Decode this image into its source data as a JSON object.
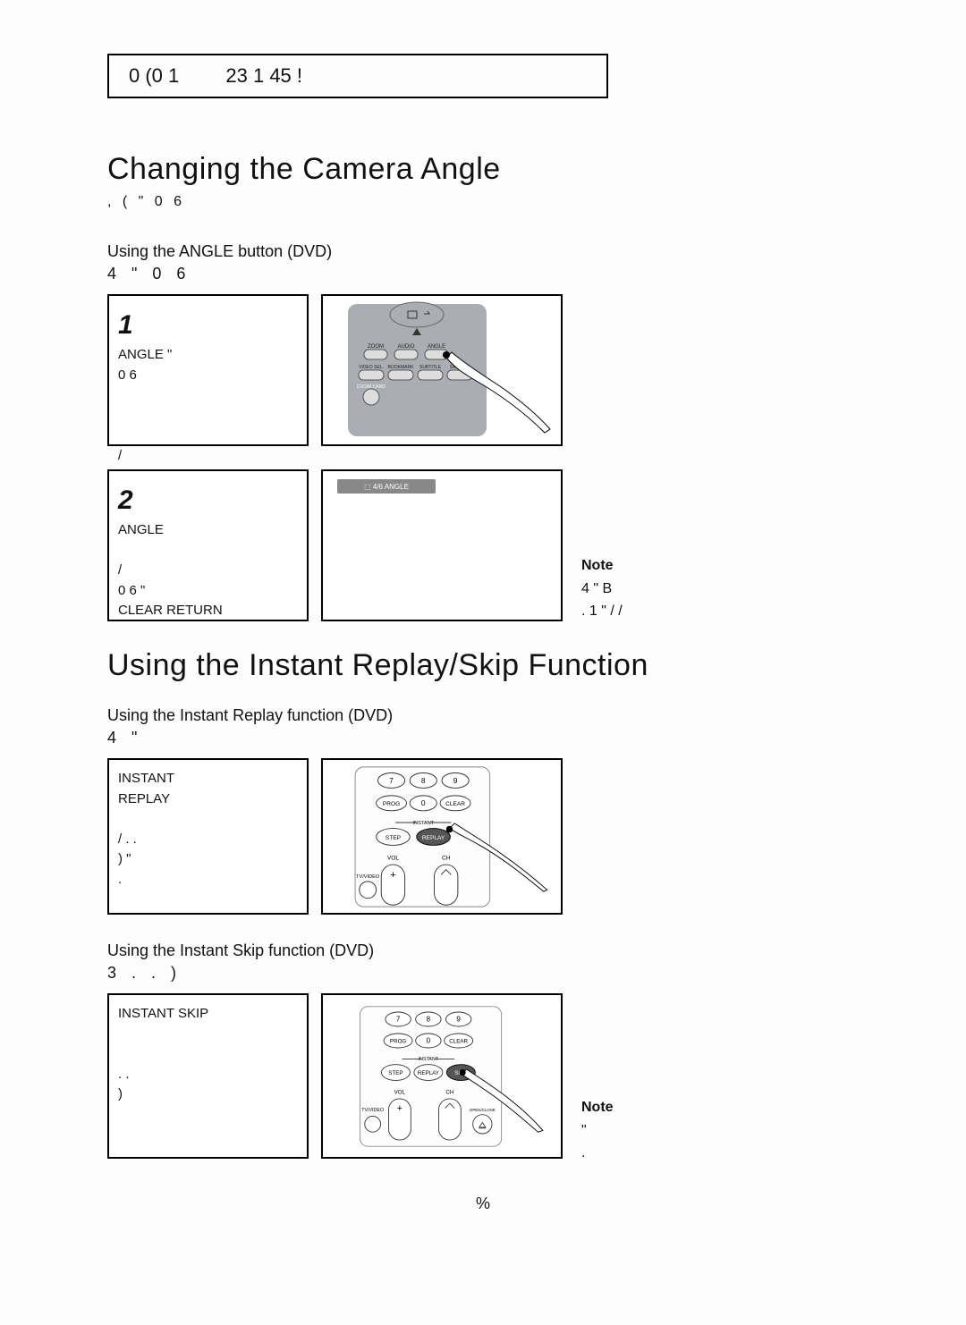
{
  "banner": {
    "left": "0 (0 1",
    "right": "23 1 45 !"
  },
  "section1": {
    "title": "Changing the Camera Angle",
    "sub": ",  (                                  \"                0 6",
    "using_line": "Using the ANGLE button (DVD)",
    "using_sub": "4                       \"   0 6",
    "step1_num": "1",
    "step1_text": "       ANGLE  \"\n 0 6\n\n\n\n/",
    "step2_num": "2",
    "step2_text": "       ANGLE\n\n       /\n 0 6  \"\nCLEAR  RETURN",
    "note_label": "Note",
    "note_text": "4                  \"           B\n   . 1       \" /         /",
    "overlay": "⬚ 4/6 ANGLE"
  },
  "section2": {
    "title": "Using the Instant Replay/Skip Function",
    "using_line": "Using the Instant Replay function (DVD)",
    "using_sub": "4               \"",
    "step_text": "        INSTANT\nREPLAY\n\n   /   .     .\n  )    \"\n  ."
  },
  "section3": {
    "using_line": "Using the Instant Skip function (DVD)",
    "using_sub": "3           .       .   )",
    "step_text": "        INSTANT SKIP\n\n\n      .      .\n )",
    "note_label": "Note",
    "note_text": "                  \"\n   ."
  },
  "remote": {
    "icons": [
      "ZOOM",
      "AUDIO",
      "ANGLE",
      "VIDEO SEL.",
      "BOOKMARK",
      "SUBTITLE",
      "SACD/CD"
    ],
    "dvdmcard": "DVD/M.CARD",
    "numbers": [
      "7",
      "8",
      "9",
      "0"
    ],
    "prog": "PROG",
    "clear": "CLEAR",
    "step": "STEP",
    "replay": "REPLAY",
    "skip": "SKIP",
    "instant": "INSTANT",
    "vol": "VOL",
    "ch": "CH",
    "tvvideo": "TV/VIDEO",
    "openclose": "OPEN/CLOSE",
    "plus": "+"
  },
  "page_number": "%"
}
